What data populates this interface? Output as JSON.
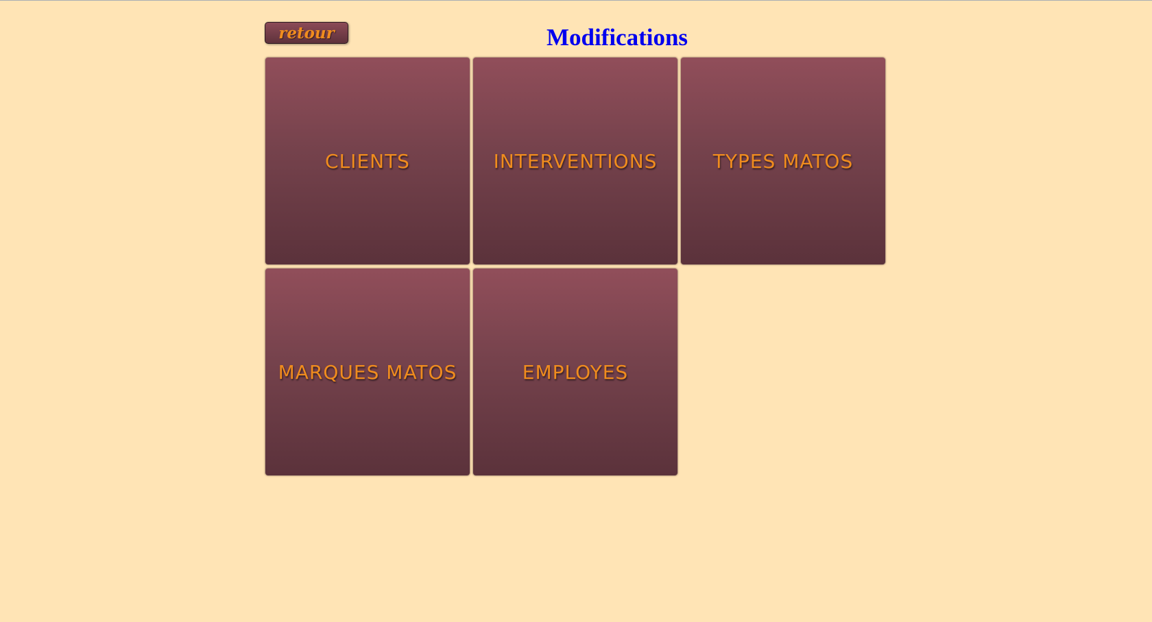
{
  "header": {
    "back_label": "retour",
    "title": "Modifications"
  },
  "tiles": [
    {
      "label": "CLIENTS"
    },
    {
      "label": "INTERVENTIONS"
    },
    {
      "label": "TYPES MATOS"
    },
    {
      "label": "MARQUES MATOS"
    },
    {
      "label": "EMPLOYES"
    }
  ],
  "colors": {
    "background": "#ffe4b5",
    "tile_top": "#914e5a",
    "tile_bottom": "#5b323b",
    "label": "#f08c1e",
    "title": "#0000ee"
  }
}
